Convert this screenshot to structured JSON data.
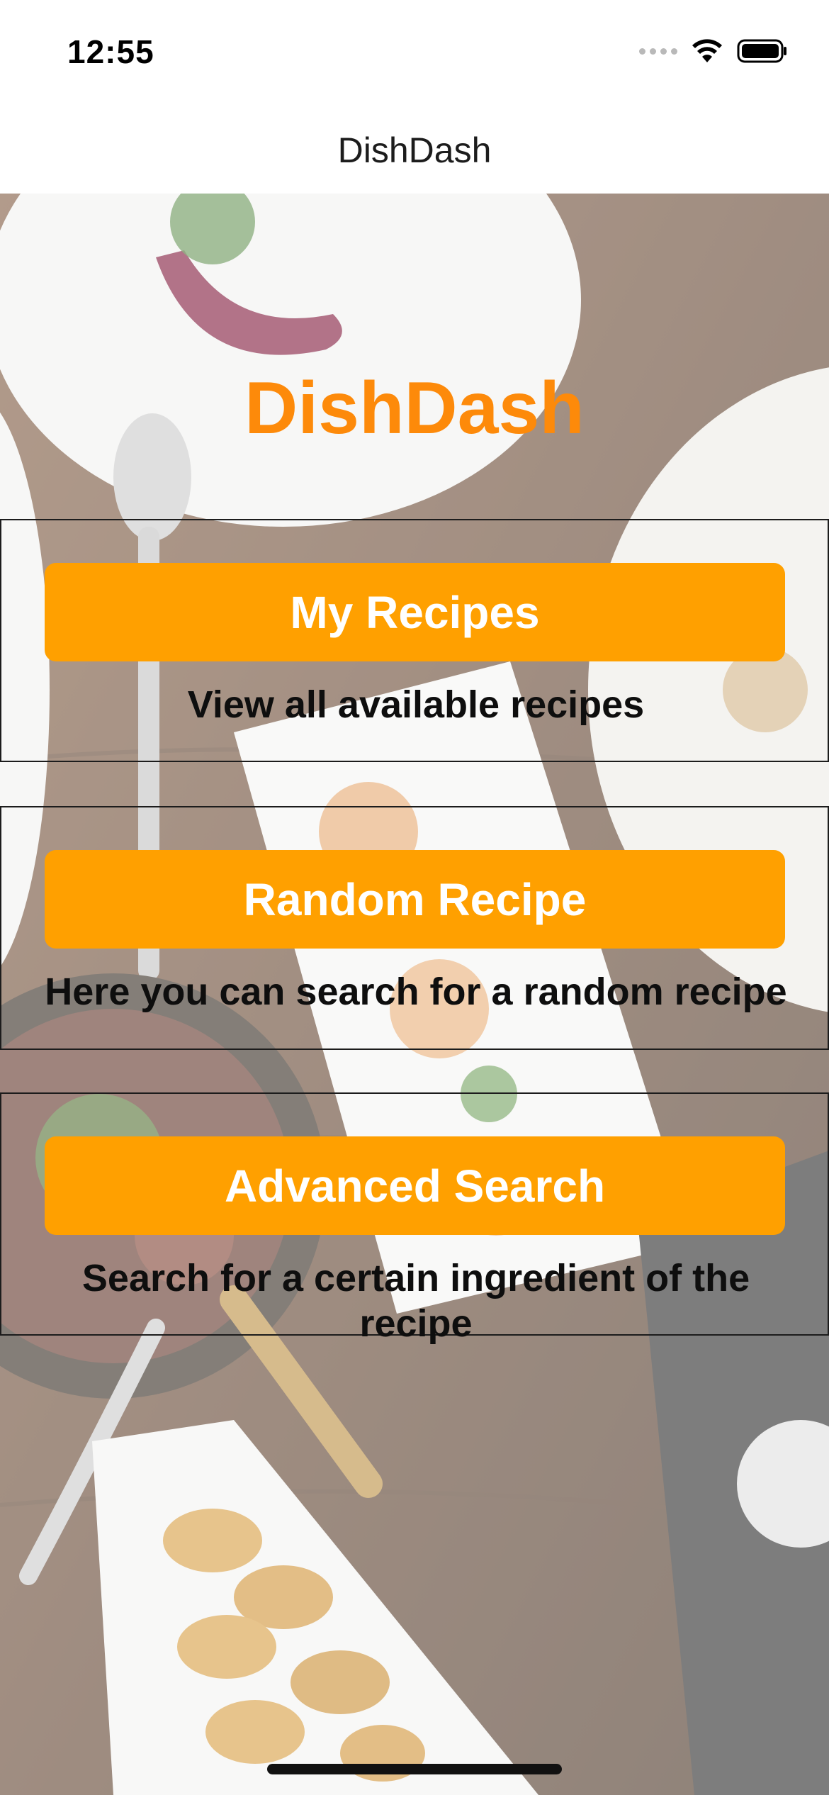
{
  "status_bar": {
    "time": "12:55",
    "icons": [
      "cellular-signal-icon",
      "wifi-icon",
      "battery-icon"
    ]
  },
  "nav": {
    "title": "DishDash"
  },
  "main": {
    "app_title": "DishDash",
    "cards": [
      {
        "button_label": "My Recipes",
        "description": "View all available recipes"
      },
      {
        "button_label": "Random Recipe",
        "description": "Here you can search for a random recipe"
      },
      {
        "button_label": "Advanced Search",
        "description": "Search for a certain ingredient of the recipe"
      }
    ]
  },
  "colors": {
    "accent": "#ffa000",
    "title_orange": "#fd8a0a",
    "background": "#ffffff"
  }
}
